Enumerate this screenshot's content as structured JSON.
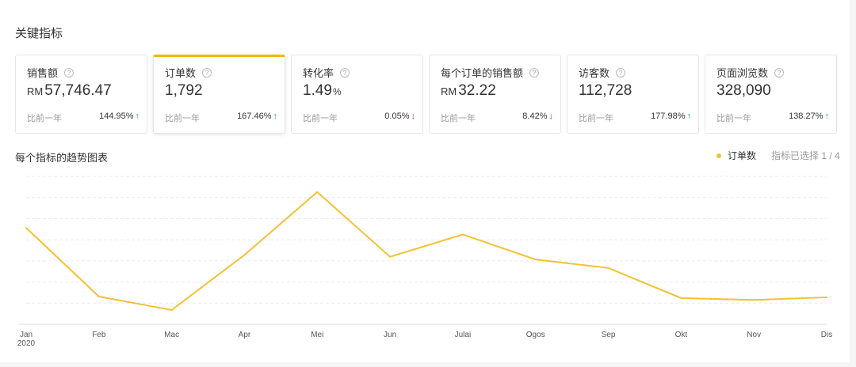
{
  "section_title": "关键指标",
  "metrics": [
    {
      "name": "销售额",
      "currency": "RM",
      "value": "57,746.47",
      "unit": "",
      "compare_label": "比前一年",
      "change": "144.95%",
      "direction": "up",
      "selected": false
    },
    {
      "name": "订单数",
      "currency": "",
      "value": "1,792",
      "unit": "",
      "compare_label": "比前一年",
      "change": "167.46%",
      "direction": "up",
      "selected": true
    },
    {
      "name": "转化率",
      "currency": "",
      "value": "1.49",
      "unit": "%",
      "compare_label": "比前一年",
      "change": "0.05%",
      "direction": "down",
      "selected": false
    },
    {
      "name": "每个订单的销售额",
      "currency": "RM",
      "value": "32.22",
      "unit": "",
      "compare_label": "比前一年",
      "change": "8.42%",
      "direction": "down",
      "selected": false
    },
    {
      "name": "访客数",
      "currency": "",
      "value": "112,728",
      "unit": "",
      "compare_label": "比前一年",
      "change": "177.98%",
      "direction": "up",
      "selected": false
    },
    {
      "name": "页面浏览数",
      "currency": "",
      "value": "328,090",
      "unit": "",
      "compare_label": "比前一年",
      "change": "138.27%",
      "direction": "up",
      "selected": false
    }
  ],
  "chart_section": {
    "title": "每个指标的趋势图表",
    "legend_label": "订单数",
    "selected_count": "指标已选择 1 / 4"
  },
  "colors": {
    "accent": "#f0b90b",
    "line": "#f5c132",
    "up": "#27b345",
    "down": "#e8332a"
  },
  "chart_data": {
    "type": "line",
    "categories": [
      "Jan",
      "Feb",
      "Mac",
      "Apr",
      "Mei",
      "Jun",
      "Julai",
      "Ogos",
      "Sep",
      "Okt",
      "Nov",
      "Dis"
    ],
    "year_label": "2020",
    "series": [
      {
        "name": "订单数",
        "values": [
          250,
          72,
          37,
          180,
          343,
          175,
          233,
          168,
          146,
          68,
          63,
          70
        ]
      }
    ],
    "ylim": [
      0,
      400
    ],
    "grid": true
  }
}
